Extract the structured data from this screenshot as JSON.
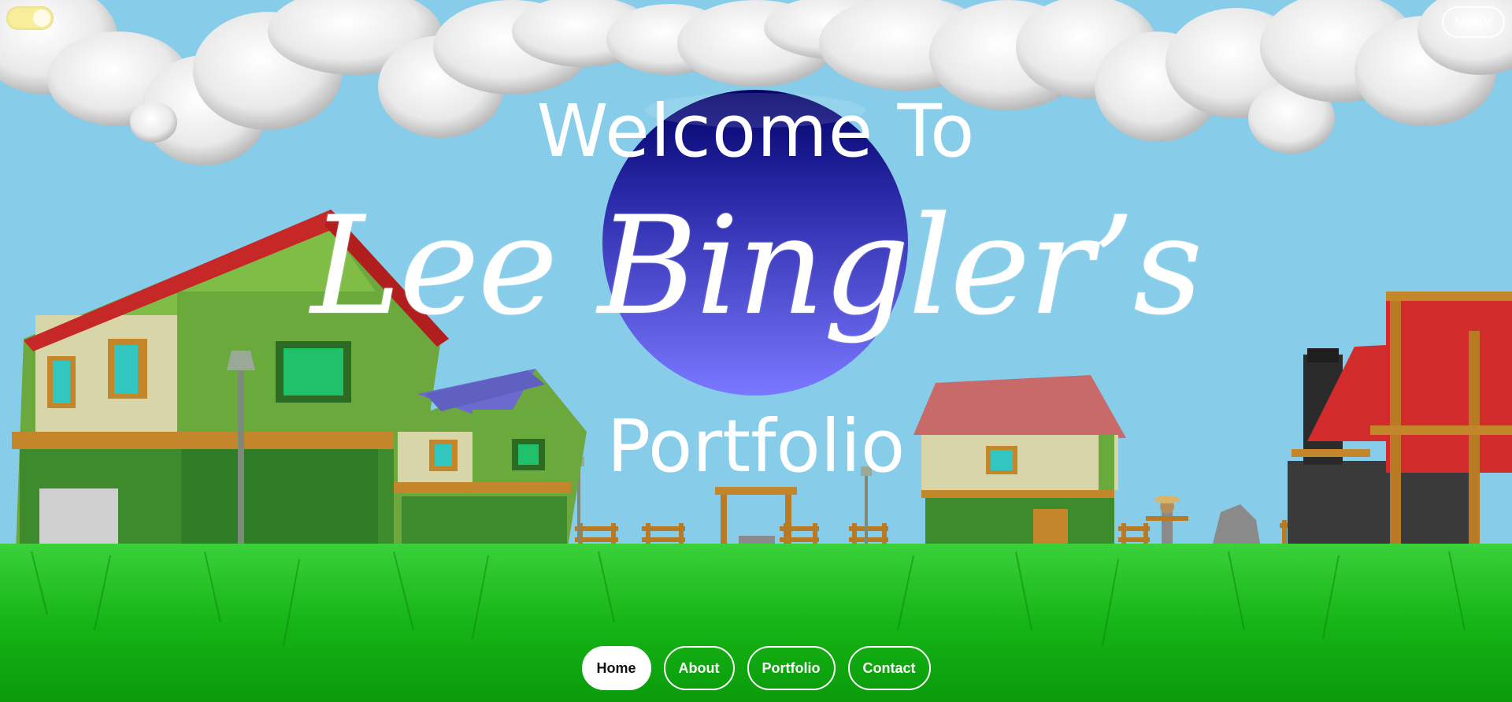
{
  "header": {
    "theme_toggle": {
      "state": "on",
      "color": "#f8ee9a"
    },
    "cv_label": "My CV"
  },
  "hero": {
    "welcome": "Welcome To",
    "name": "Lee Bingler’s",
    "subtitle": "Portfolio"
  },
  "nav": {
    "items": [
      {
        "label": "Home",
        "active": true
      },
      {
        "label": "About",
        "active": false
      },
      {
        "label": "Portfolio",
        "active": false
      },
      {
        "label": "Contact",
        "active": false
      }
    ]
  },
  "colors": {
    "sky": "#87cdea",
    "grass": "#1fb81f",
    "orb_top": "#000080",
    "orb_bottom": "#7878ff",
    "text": "#ffffff"
  }
}
